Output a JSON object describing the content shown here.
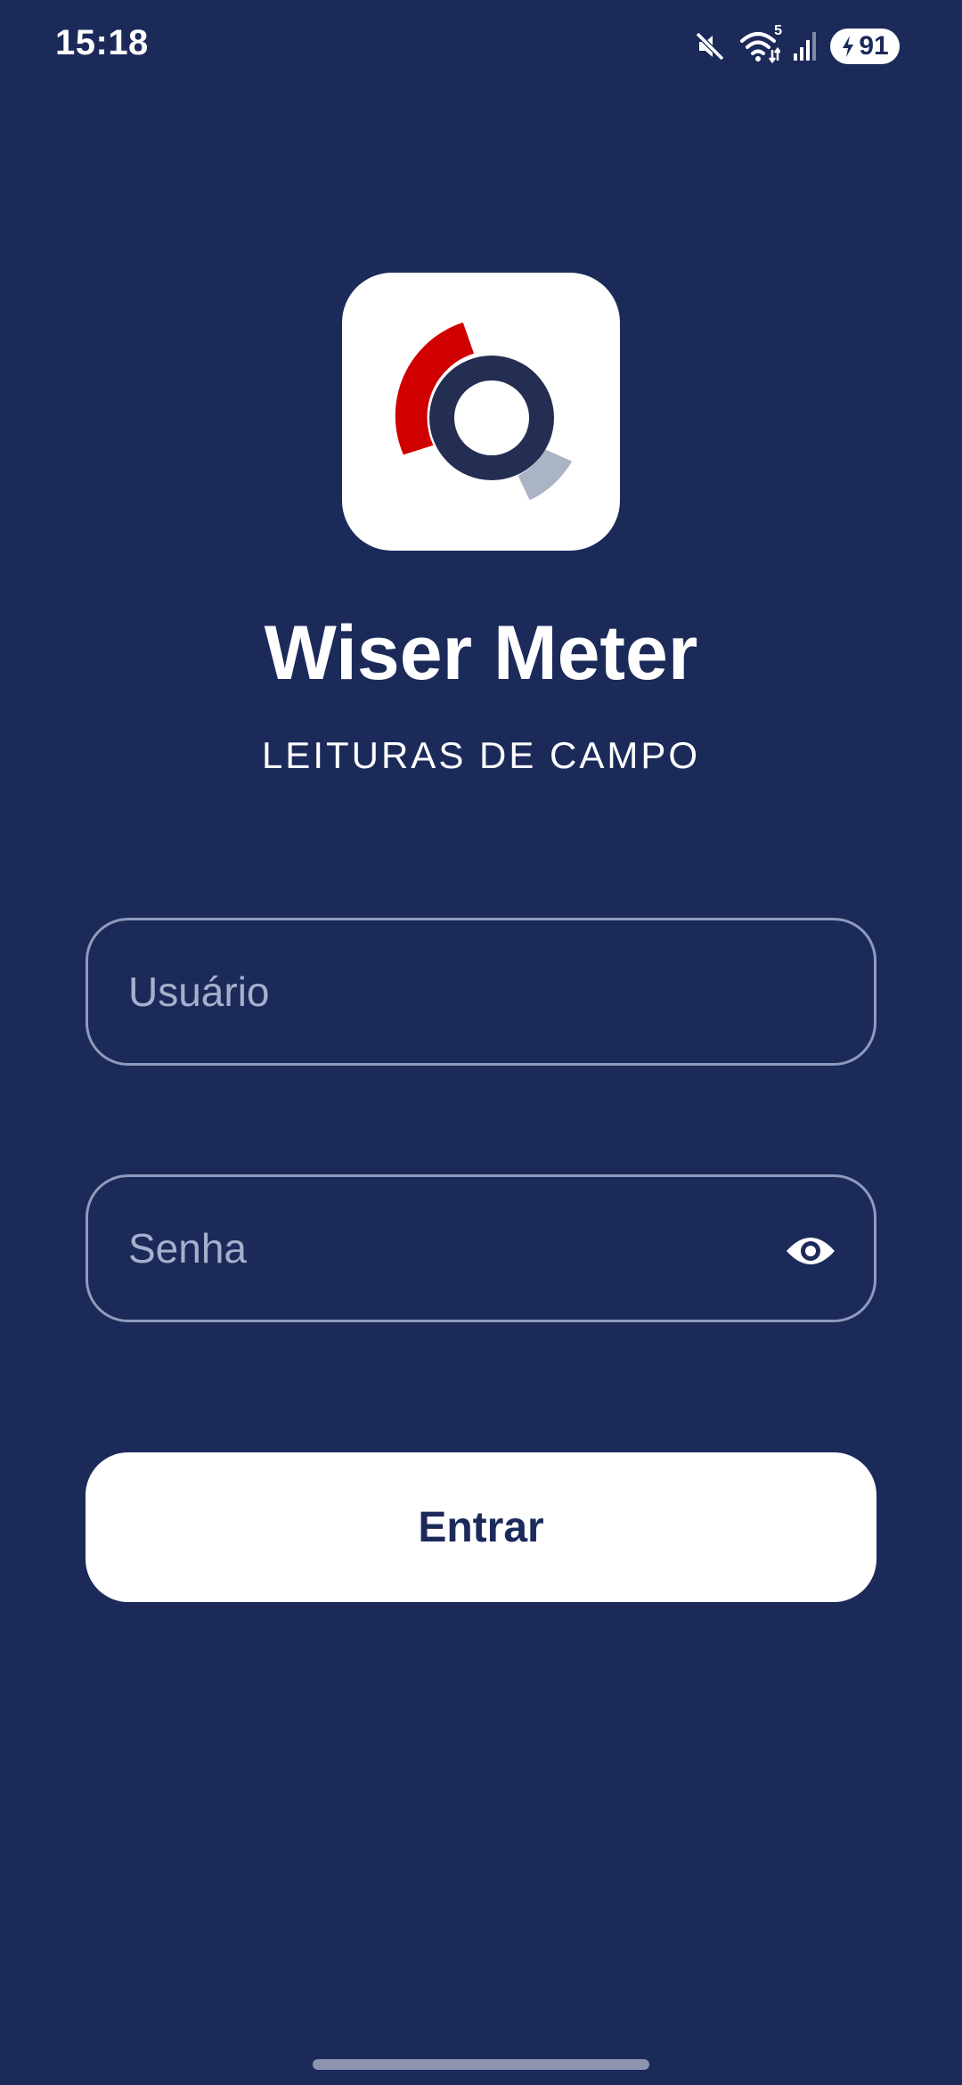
{
  "status_bar": {
    "time": "15:18",
    "battery_level": "91",
    "network_label": "5",
    "icons": [
      "mute-icon",
      "wifi-icon",
      "signal-icon",
      "battery-charging-icon"
    ]
  },
  "app": {
    "title": "Wiser Meter",
    "subtitle": "LEITURAS DE CAMPO",
    "logo": "wiser-meter-logo"
  },
  "login_form": {
    "username_placeholder": "Usuário",
    "username_value": "",
    "password_placeholder": "Senha",
    "password_value": "",
    "password_toggle_icon": "eye-icon",
    "submit_label": "Entrar"
  },
  "colors": {
    "background": "#1c2a5a",
    "logo_red": "#d10000",
    "logo_navy": "#242d52",
    "logo_grey": "#aab4c4",
    "field_border": "#8f9bbd",
    "placeholder": "#a5b0cc",
    "button_background": "#ffffff",
    "button_text": "#1c2a5a"
  }
}
